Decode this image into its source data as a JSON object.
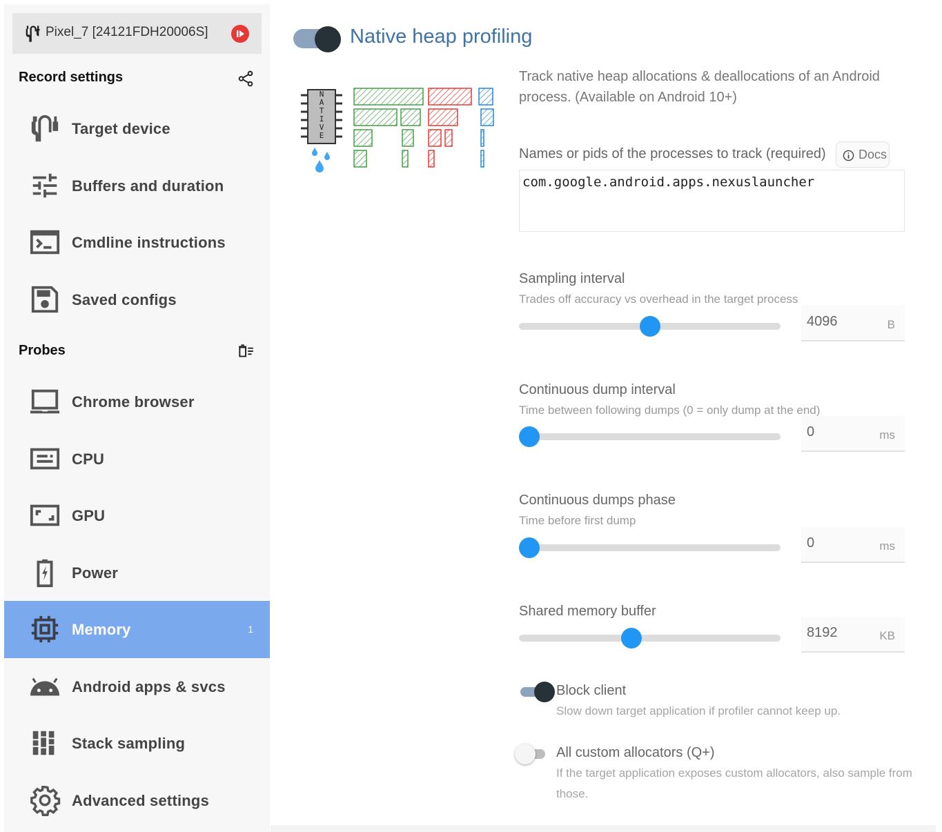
{
  "device": {
    "name": "Pixel_7 [24121FDH20006S]",
    "usb_icon": "usb-cable-icon",
    "record_icon": "record-icon"
  },
  "record_settings": {
    "title": "Record settings",
    "share_icon": "share-icon",
    "items": [
      {
        "label": "Target device",
        "icon": "usb-cable-icon"
      },
      {
        "label": "Buffers and duration",
        "icon": "tune-sliders-icon"
      },
      {
        "label": "Cmdline instructions",
        "icon": "terminal-icon"
      },
      {
        "label": "Saved configs",
        "icon": "save-icon"
      }
    ]
  },
  "probes": {
    "title": "Probes",
    "clear_icon": "clear-list-icon",
    "items": [
      {
        "label": "Chrome browser",
        "icon": "laptop-icon"
      },
      {
        "label": "CPU",
        "icon": "cpu-bar-icon"
      },
      {
        "label": "GPU",
        "icon": "gpu-frame-icon"
      },
      {
        "label": "Power",
        "icon": "battery-charging-icon"
      },
      {
        "label": "Memory",
        "icon": "memory-chip-icon",
        "badge": "1",
        "active": true
      },
      {
        "label": "Android apps & svcs",
        "icon": "android-icon"
      },
      {
        "label": "Stack sampling",
        "icon": "grid-icon"
      },
      {
        "label": "Advanced settings",
        "icon": "gear-icon"
      }
    ]
  },
  "probe": {
    "title": "Native heap profiling",
    "enabled": true,
    "description": "Track native heap allocations & deallocations of an Android process. (Available on Android 10+)",
    "illustration_text": "NATIVE",
    "processes": {
      "label": "Names or pids of the processes to track (required)",
      "docs_label": "Docs",
      "value": "com.google.android.apps.nexuslauncher"
    },
    "sampling_interval": {
      "label": "Sampling interval",
      "sublabel": "Trades off accuracy vs overhead in the target process",
      "value": "4096",
      "unit": "B",
      "slider_fraction": 0.5
    },
    "continuous_dump_interval": {
      "label": "Continuous dump interval",
      "sublabel": "Time between following dumps (0 = only dump at the end)",
      "value": "0",
      "unit": "ms",
      "slider_fraction": 0.04
    },
    "continuous_dumps_phase": {
      "label": "Continuous dumps phase",
      "sublabel": "Time before first dump",
      "value": "0",
      "unit": "ms",
      "slider_fraction": 0.04
    },
    "shared_memory_buffer": {
      "label": "Shared memory buffer",
      "value": "8192",
      "unit": "KB",
      "slider_fraction": 0.43
    },
    "block_client": {
      "label": "Block client",
      "sublabel": "Slow down target application if profiler cannot keep up.",
      "enabled": true
    },
    "all_custom_allocators": {
      "label": "All custom allocators (Q+)",
      "sublabel": "If the target application exposes custom allocators, also sample from those.",
      "enabled": false
    }
  },
  "colors": {
    "accent": "#2196f3",
    "active_nav": "#7aa9ee",
    "title": "#3d73a8",
    "toggle_knob": "#263238",
    "record_red": "#e53935"
  }
}
